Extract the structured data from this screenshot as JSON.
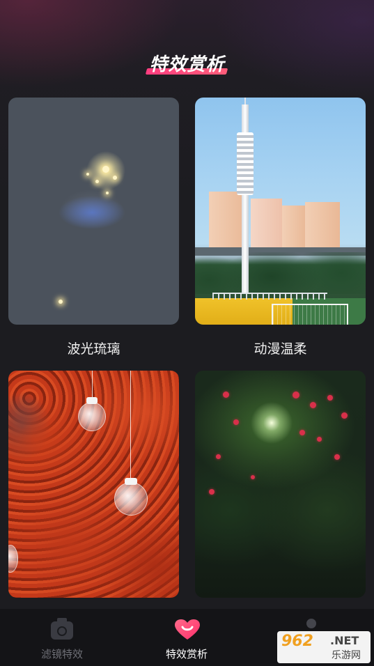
{
  "header": {
    "title": "特效赏析"
  },
  "gallery": {
    "items": [
      {
        "label": "波光琉璃"
      },
      {
        "label": "动漫温柔"
      },
      {
        "label": ""
      },
      {
        "label": ""
      }
    ]
  },
  "bottom_nav": {
    "items": [
      {
        "label": "滤镜特效",
        "icon": "camera-icon",
        "active": false
      },
      {
        "label": "特效赏析",
        "icon": "heart-icon",
        "active": true
      },
      {
        "label": "",
        "icon": "profile-icon",
        "active": false
      }
    ]
  },
  "watermark": {
    "number": "962",
    "domain": ".NET",
    "text": "乐游网"
  },
  "colors": {
    "accent": "#ff3d7f",
    "background": "#1c1c20",
    "nav_background": "#141417"
  }
}
